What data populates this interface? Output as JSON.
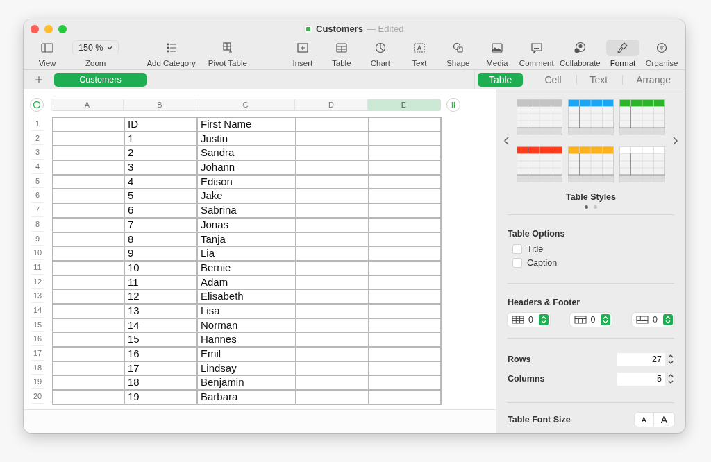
{
  "window": {
    "title": "Customers",
    "status": "— Edited"
  },
  "toolbar": [
    {
      "kind": "view",
      "label": "View",
      "selected": false
    },
    {
      "kind": "zoom",
      "label": "Zoom",
      "value": "150 %"
    },
    {
      "kind": "category",
      "label": "Add Category",
      "selected": false
    },
    {
      "kind": "pivot",
      "label": "Pivot Table",
      "selected": false
    },
    {
      "kind": "insert",
      "label": "Insert",
      "selected": false
    },
    {
      "kind": "table",
      "label": "Table",
      "selected": false
    },
    {
      "kind": "chart",
      "label": "Chart",
      "selected": false
    },
    {
      "kind": "text",
      "label": "Text",
      "selected": false
    },
    {
      "kind": "shape",
      "label": "Shape",
      "selected": false
    },
    {
      "kind": "media",
      "label": "Media",
      "selected": false
    },
    {
      "kind": "comment",
      "label": "Comment",
      "selected": false
    },
    {
      "kind": "collaborate",
      "label": "Collaborate",
      "selected": false
    },
    {
      "kind": "format",
      "label": "Format",
      "selected": true
    },
    {
      "kind": "organise",
      "label": "Organise",
      "selected": false
    }
  ],
  "sheets": [
    {
      "label": "Customers",
      "selected": true
    }
  ],
  "inspector_tabs": [
    {
      "label": "Table",
      "selected": true
    },
    {
      "label": "Cell",
      "selected": false
    },
    {
      "label": "Text",
      "selected": false
    },
    {
      "label": "Arrange",
      "selected": false
    }
  ],
  "table": {
    "columns": [
      {
        "label": "A",
        "selected": false
      },
      {
        "label": "B",
        "selected": false
      },
      {
        "label": "C",
        "selected": false
      },
      {
        "label": "D",
        "selected": false
      },
      {
        "label": "E",
        "selected": true
      }
    ],
    "rows": [
      {
        "number": "1",
        "cells": [
          "",
          "ID",
          "First Name",
          "",
          ""
        ]
      },
      {
        "number": "2",
        "cells": [
          "",
          "1",
          "Justin",
          "",
          ""
        ]
      },
      {
        "number": "3",
        "cells": [
          "",
          "2",
          "Sandra",
          "",
          ""
        ]
      },
      {
        "number": "4",
        "cells": [
          "",
          "3",
          "Johann",
          "",
          ""
        ]
      },
      {
        "number": "5",
        "cells": [
          "",
          "4",
          "Edison",
          "",
          ""
        ]
      },
      {
        "number": "6",
        "cells": [
          "",
          "5",
          "Jake",
          "",
          ""
        ]
      },
      {
        "number": "7",
        "cells": [
          "",
          "6",
          "Sabrina",
          "",
          ""
        ]
      },
      {
        "number": "8",
        "cells": [
          "",
          "7",
          "Jonas",
          "",
          ""
        ]
      },
      {
        "number": "9",
        "cells": [
          "",
          "8",
          "Tanja",
          "",
          ""
        ]
      },
      {
        "number": "10",
        "cells": [
          "",
          "9",
          "Lia",
          "",
          ""
        ]
      },
      {
        "number": "11",
        "cells": [
          "",
          "10",
          "Bernie",
          "",
          ""
        ]
      },
      {
        "number": "12",
        "cells": [
          "",
          "11",
          "Adam",
          "",
          ""
        ]
      },
      {
        "number": "13",
        "cells": [
          "",
          "12",
          "Elisabeth",
          "",
          ""
        ]
      },
      {
        "number": "14",
        "cells": [
          "",
          "13",
          "Lisa",
          "",
          ""
        ]
      },
      {
        "number": "15",
        "cells": [
          "",
          "14",
          "Norman",
          "",
          ""
        ]
      },
      {
        "number": "16",
        "cells": [
          "",
          "15",
          "Hannes",
          "",
          ""
        ]
      },
      {
        "number": "17",
        "cells": [
          "",
          "16",
          "Emil",
          "",
          ""
        ]
      },
      {
        "number": "18",
        "cells": [
          "",
          "17",
          "Lindsay",
          "",
          ""
        ]
      },
      {
        "number": "19",
        "cells": [
          "",
          "18",
          "Benjamin",
          "",
          ""
        ]
      },
      {
        "number": "20",
        "cells": [
          "",
          "19",
          "Barbara",
          "",
          ""
        ]
      }
    ]
  },
  "inspector": {
    "table_styles": {
      "title": "Table Styles",
      "styles": [
        {
          "color": "#c4c4c4"
        },
        {
          "color": "#1aa6f5"
        },
        {
          "color": "#2db52a"
        },
        {
          "color": "#ff3b1d"
        },
        {
          "color": "#fcb21f"
        },
        {
          "color": "#ffffff"
        }
      ],
      "pages": [
        {
          "selected": true
        },
        {
          "selected": false
        }
      ]
    },
    "table_options": {
      "title": "Table Options",
      "options": [
        {
          "label": "Title",
          "checked": false
        },
        {
          "label": "Caption",
          "checked": false
        }
      ]
    },
    "headers_footer": {
      "title": "Headers & Footer",
      "controls": [
        {
          "kind": "header-rows",
          "value": "0"
        },
        {
          "kind": "header-columns",
          "value": "0"
        },
        {
          "kind": "footer-rows",
          "value": "0"
        }
      ]
    },
    "rows": {
      "label": "Rows",
      "value": "27"
    },
    "columns": {
      "label": "Columns",
      "value": "5"
    },
    "font_size": {
      "label": "Table Font Size",
      "smaller": "A",
      "larger": "A"
    }
  }
}
